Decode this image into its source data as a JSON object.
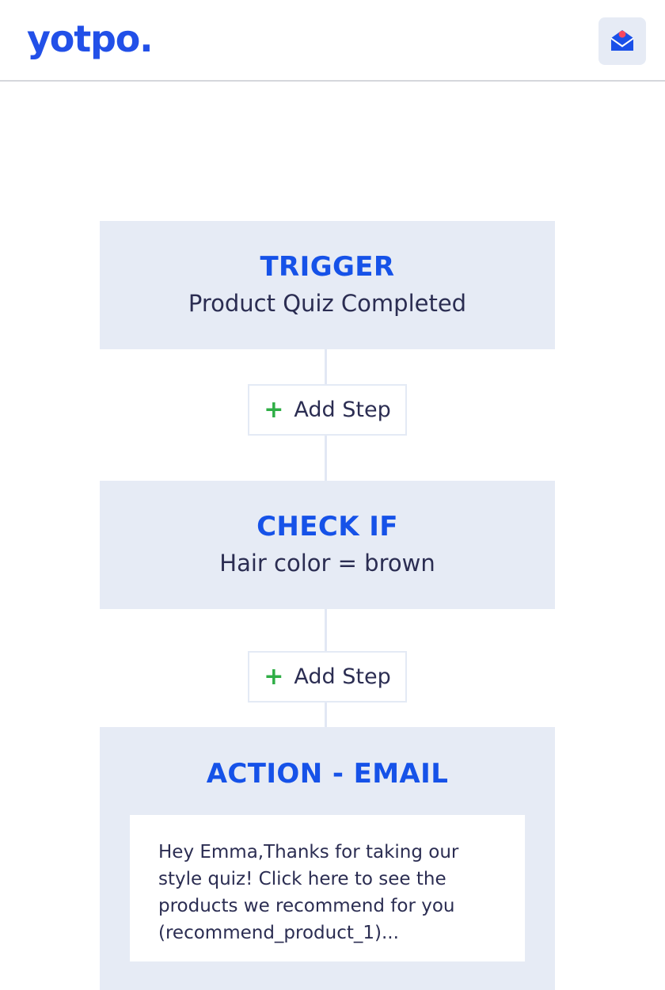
{
  "header": {
    "logo_text": "yotpo.",
    "mail_icon_name": "open-envelope-notification-icon",
    "brand_color": "#2250e8",
    "notification_dot_color": "#f8475f",
    "tile_color": "#e6ebf5"
  },
  "flow": {
    "nodes": [
      {
        "kind": "trigger",
        "title": "TRIGGER",
        "subtitle": "Product Quiz Completed"
      },
      {
        "kind": "check",
        "title": "CHECK IF",
        "subtitle": "Hair color = brown"
      },
      {
        "kind": "action",
        "title": "ACTION - EMAIL",
        "email_body": "Hey Emma,Thanks for taking our style quiz! Click here to see the products we recommend for you (recommend_product_1)..."
      }
    ],
    "add_step_buttons": [
      {
        "plus": "+",
        "label": "Add Step"
      },
      {
        "plus": "+",
        "label": "Add Step"
      }
    ],
    "colors": {
      "node_background": "#e6ebf5",
      "node_title": "#1652e8",
      "node_text": "#2b2d52",
      "connector": "#e2e8f4",
      "plus": "#2fae46",
      "button_border": "#e4eaf5"
    }
  }
}
